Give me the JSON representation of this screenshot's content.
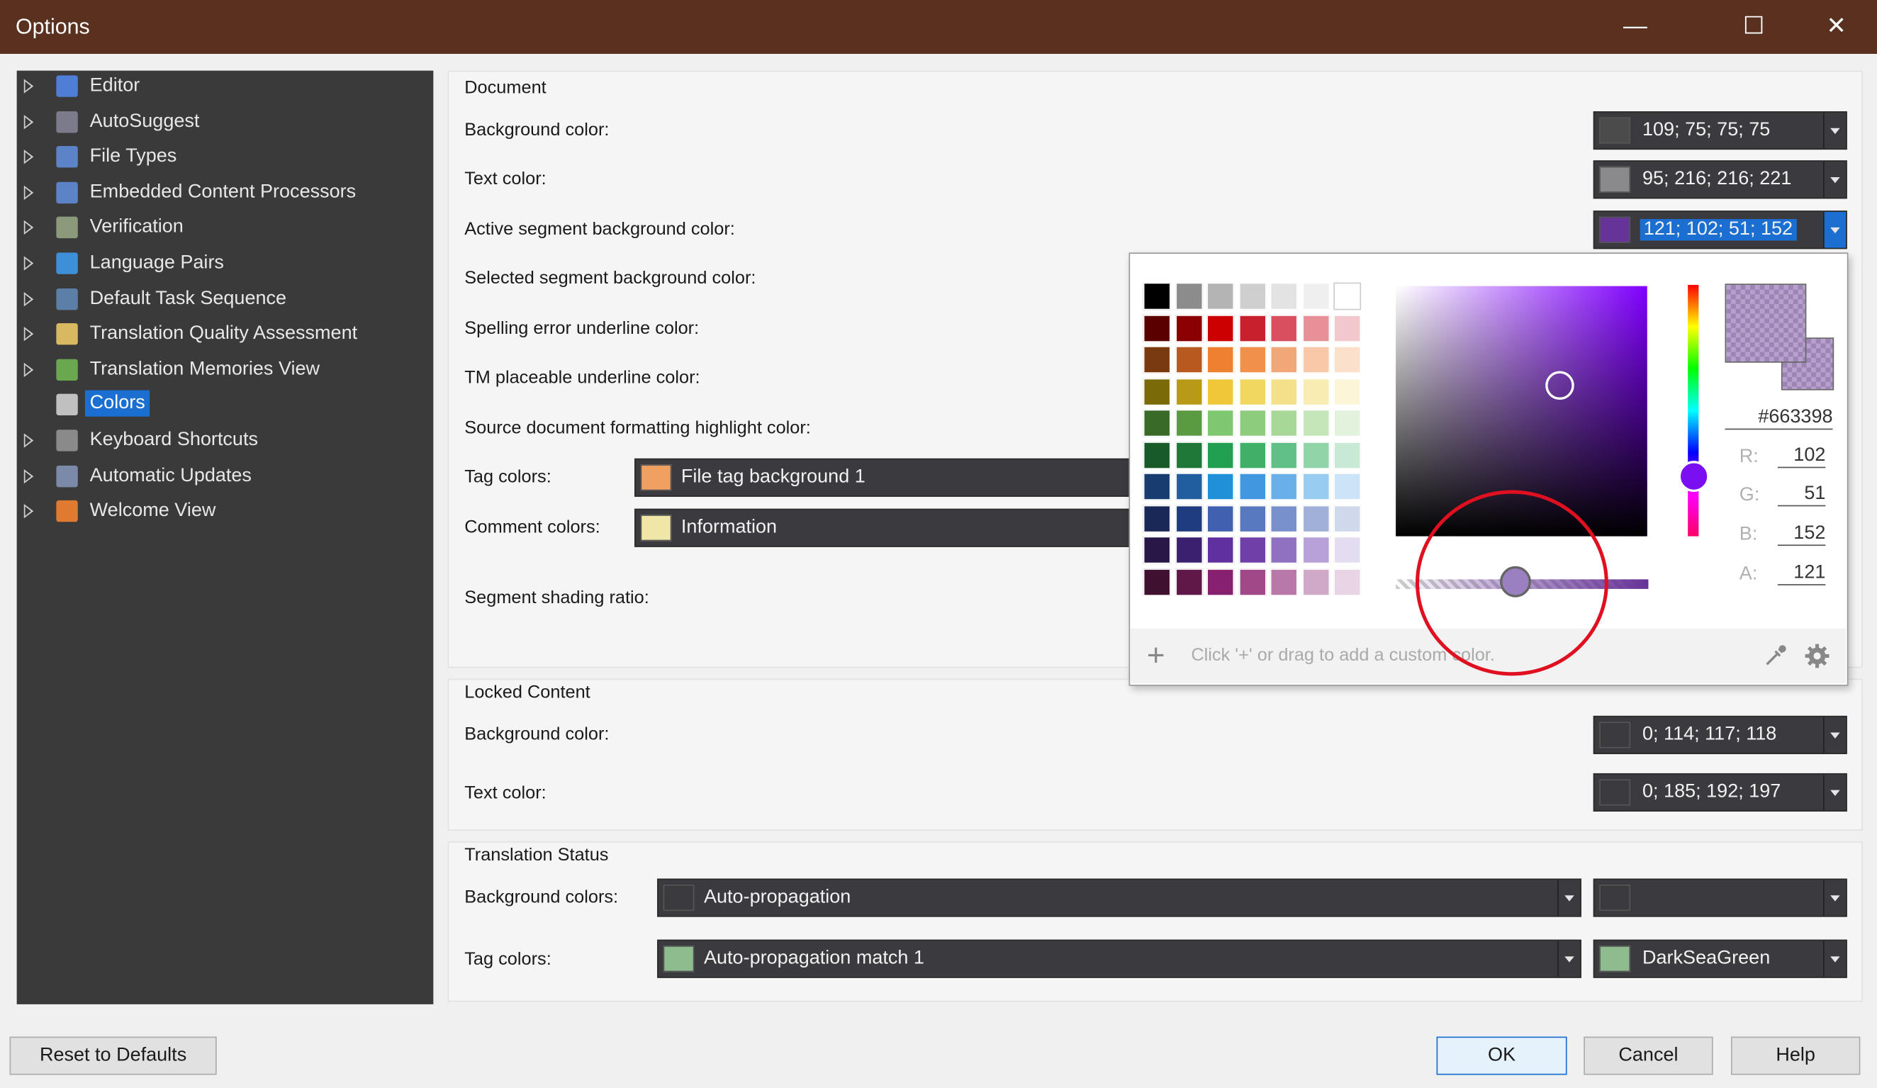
{
  "window": {
    "title": "Options",
    "minimize_glyph": "—",
    "maximize_glyph": "☐",
    "close_glyph": "✕"
  },
  "sidebar": {
    "items": [
      {
        "label": "Editor",
        "icon": "pencil-icon",
        "color": "#4f7ed6"
      },
      {
        "label": "AutoSuggest",
        "icon": "autosuggest-icon",
        "color": "#7b7b8c"
      },
      {
        "label": "File Types",
        "icon": "file-types-icon",
        "color": "#5c82c8"
      },
      {
        "label": "Embedded Content Processors",
        "icon": "embedded-content-icon",
        "color": "#5c82c8"
      },
      {
        "label": "Verification",
        "icon": "verification-icon",
        "color": "#8a9a7a"
      },
      {
        "label": "Language Pairs",
        "icon": "language-pairs-icon",
        "color": "#3d8fd8"
      },
      {
        "label": "Default Task Sequence",
        "icon": "task-sequence-icon",
        "color": "#5c7fa8"
      },
      {
        "label": "Translation Quality Assessment",
        "icon": "quality-assessment-icon",
        "color": "#d8b860"
      },
      {
        "label": "Translation Memories View",
        "icon": "translation-memories-icon",
        "color": "#6aa84f"
      },
      {
        "label": "Colors",
        "icon": "palette-icon",
        "color": "#c0c0c0",
        "selected": true
      },
      {
        "label": "Keyboard Shortcuts",
        "icon": "keyboard-icon",
        "color": "#8a8a8a"
      },
      {
        "label": "Automatic Updates",
        "icon": "updates-icon",
        "color": "#7a8aa8"
      },
      {
        "label": "Welcome View",
        "icon": "home-icon",
        "color": "#e07a30"
      }
    ]
  },
  "document": {
    "title": "Document",
    "background_label": "Background color:",
    "background_value": "109; 75; 75; 75",
    "background_swatch": "#4b4b4b",
    "text_label": "Text color:",
    "text_value": "95; 216; 216; 221",
    "text_swatch": "#8a8a8c",
    "active_label": "Active segment background color:",
    "active_value": "121; 102; 51; 152",
    "active_swatch": "#663398",
    "selected_label": "Selected segment background color:",
    "spelling_label": "Spelling error underline color:",
    "tm_label": "TM placeable underline color:",
    "source_label": "Source document formatting highlight color:",
    "tag_label": "Tag colors:",
    "tag_value": "File tag background 1",
    "tag_swatch": "#f0a060",
    "comment_label": "Comment colors:",
    "comment_value": "Information",
    "comment_swatch": "#f0e6a8",
    "shading_label": "Segment shading ratio:"
  },
  "color_picker": {
    "hex": "#663398",
    "r_label": "R:",
    "r": "102",
    "g_label": "G:",
    "g": "51",
    "b_label": "B:",
    "b": "152",
    "a_label": "A:",
    "a": "121",
    "custom_hint": "Click '+' or drag to add a custom color.",
    "plus_glyph": "+",
    "palette": [
      [
        "#000000",
        "#8c8c8c",
        "#b4b4b4",
        "#cfcfcf",
        "#e3e3e3",
        "#efefef",
        "#ffffff"
      ],
      [
        "#5a0000",
        "#8b0000",
        "#cc0000",
        "#c8202c",
        "#d85060",
        "#e89098",
        "#f2c8cc"
      ],
      [
        "#7a3a10",
        "#b85a20",
        "#ee8030",
        "#f0904a",
        "#f0a878",
        "#f8c8a8",
        "#fbe0cc"
      ],
      [
        "#7a6a08",
        "#b89a18",
        "#eec838",
        "#f0d860",
        "#f4e088",
        "#f8ecb0",
        "#fcf5d8"
      ],
      [
        "#3a6a28",
        "#5a9a40",
        "#80c870",
        "#8ccc7c",
        "#a8d898",
        "#c4e6b8",
        "#e2f2dc"
      ],
      [
        "#185a28",
        "#207838",
        "#20a050",
        "#40b068",
        "#60c088",
        "#90d4a8",
        "#c8ead4"
      ],
      [
        "#183c70",
        "#205ea0",
        "#2090d8",
        "#4098e0",
        "#68b0e8",
        "#98ccf0",
        "#cce4f8"
      ],
      [
        "#1a2858",
        "#203c80",
        "#4060b0",
        "#5878c0",
        "#7890cc",
        "#a0b0d8",
        "#d0d8ec"
      ],
      [
        "#281848",
        "#3c2070",
        "#6030a0",
        "#7040a8",
        "#9070c0",
        "#b8a0d8",
        "#e4dcf0"
      ],
      [
        "#401030",
        "#601848",
        "#882070",
        "#a04888",
        "#b878a8",
        "#d0a8c8",
        "#e8d4e4"
      ]
    ]
  },
  "locked": {
    "title": "Locked Content",
    "background_label": "Background color:",
    "background_value": "0; 114; 117; 118",
    "text_label": "Text color:",
    "text_value": "0; 185; 192; 197"
  },
  "status": {
    "title": "Translation Status",
    "background_label": "Background colors:",
    "background_value": "Auto-propagation",
    "background_right_value": "",
    "tag_label": "Tag colors:",
    "tag_value": "Auto-propagation match 1",
    "tag_swatch": "#8fbc8f",
    "tag_right_value": "DarkSeaGreen"
  },
  "buttons": {
    "reset": "Reset to Defaults",
    "ok": "OK",
    "cancel": "Cancel",
    "help": "Help"
  },
  "accent_colors": {
    "selection_blue": "#1a6fd1",
    "annotation_red": "#e01020",
    "title_bar": "#5a301e"
  }
}
